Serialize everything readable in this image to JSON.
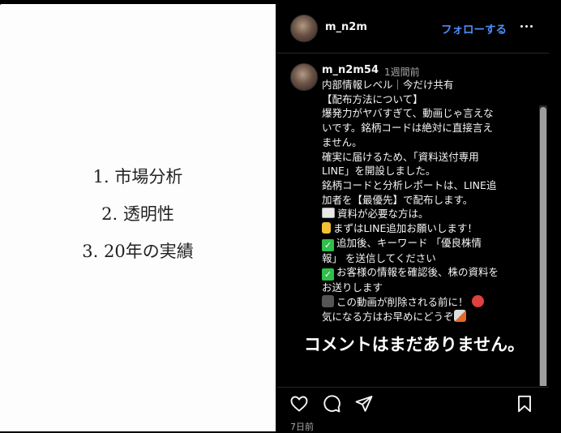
{
  "media": {
    "lines": [
      "1. 市場分析",
      "2. 透明性",
      "3. 20年の実績"
    ]
  },
  "header": {
    "username": "m_n2m",
    "follow_label": "フォローする",
    "more_icon": "more-horizontal-icon"
  },
  "caption": {
    "username": "m_n2m54",
    "time_ago": "1週間前",
    "lines": [
      "内部情報レベル｜今だけ共有",
      "【配布方法について】",
      "爆発力がヤバすぎて、動画じゃ言えな",
      "いです。銘柄コードは絶対に直接言え",
      "ません。",
      "確実に届けるため、「資料送付専用",
      "LINE」を開設しました。",
      "銘柄コードと分析レポートは、LINE追",
      "加者を【最優先】で配布します。",
      "資料が必要な方は。",
      "まずはLINE追加お願いします！",
      "追加後、キーワード 「優良株情",
      "報」 を送信してください",
      "お客様の情報を確認後、株の資料を",
      "お送りします",
      "この動画が削除される前に！",
      "気になる方はお早めにどうぞ"
    ],
    "emoji": {
      "mail": "envelope-emoji",
      "point": "pointing-down-emoji",
      "check": "check-mark-emoji",
      "camera": "video-camera-emoji",
      "clock": "alarm-clock-emoji",
      "rocket": "rocket-emoji"
    }
  },
  "comments": {
    "empty_text": "コメントはまだありません。"
  },
  "actions": {
    "like_icon": "heart-icon",
    "comment_icon": "comment-icon",
    "share_icon": "share-icon",
    "save_icon": "bookmark-icon",
    "date": "7日前"
  },
  "colors": {
    "accent": "#4d8ef7",
    "panel_bg": "#000000",
    "media_bg": "#fdfdfd",
    "muted_text": "#a8a8a8"
  }
}
